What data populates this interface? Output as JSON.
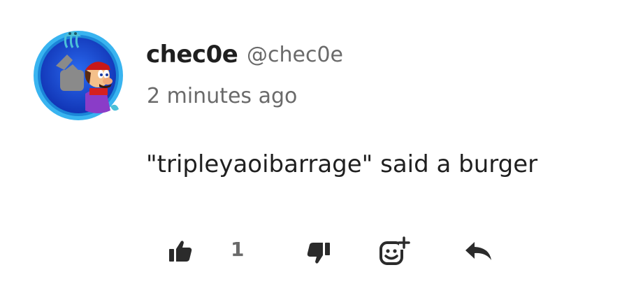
{
  "comment": {
    "username": "chec0e",
    "handle": "@chec0e",
    "timestamp": "2 minutes ago",
    "text": "\"tripleyaoibarrage\" said a burger"
  },
  "actions": {
    "like_count": "1",
    "icons": {
      "like": "thumbs-up-icon",
      "dislike": "thumbs-down-icon",
      "react": "add-emoji-reaction-icon",
      "reply": "reply-arrow-icon"
    }
  },
  "colors": {
    "text_primary": "#1f1f1f",
    "text_secondary": "#6a6a6a",
    "icon": "#2b2b2b",
    "avatar_ring": "#2aa0e6",
    "avatar_bg": "#1a45c8"
  }
}
